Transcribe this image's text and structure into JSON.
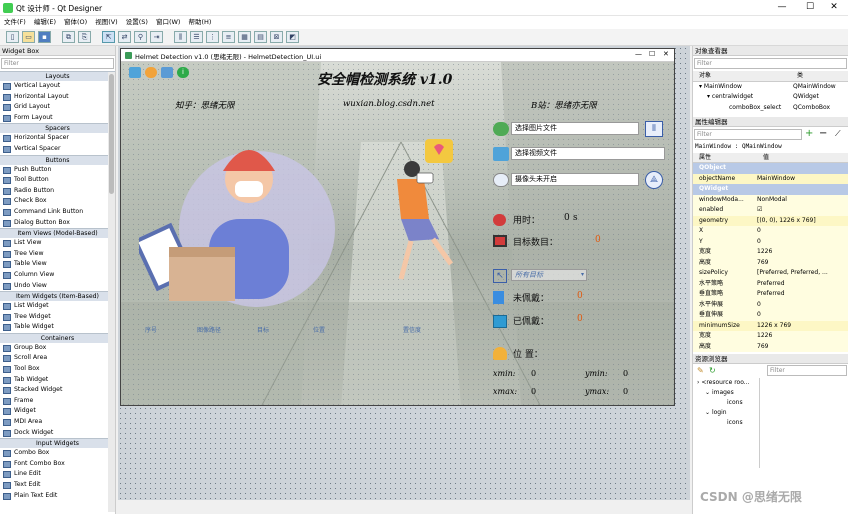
{
  "window": {
    "title": "Qt 设计师 - Qt Designer",
    "minimize": "—",
    "maximize": "☐",
    "close": "✕"
  },
  "menu": [
    "文件(F)",
    "编辑(E)",
    "窗体(O)",
    "视图(V)",
    "设置(S)",
    "窗口(W)",
    "帮助(H)"
  ],
  "widget_box": {
    "title": "Widget Box",
    "filter_placeholder": "Filter",
    "sections": [
      {
        "name": "Layouts",
        "items": [
          "Vertical Layout",
          "Horizontal Layout",
          "Grid Layout",
          "Form Layout"
        ]
      },
      {
        "name": "Spacers",
        "items": [
          "Horizontal Spacer",
          "Vertical Spacer"
        ]
      },
      {
        "name": "Buttons",
        "items": [
          "Push Button",
          "Tool Button",
          "Radio Button",
          "Check Box",
          "Command Link Button",
          "Dialog Button Box"
        ]
      },
      {
        "name": "Item Views (Model-Based)",
        "items": [
          "List View",
          "Tree View",
          "Table View",
          "Column View",
          "Undo View"
        ]
      },
      {
        "name": "Item Widgets (Item-Based)",
        "items": [
          "List Widget",
          "Tree Widget",
          "Table Widget"
        ]
      },
      {
        "name": "Containers",
        "items": [
          "Group Box",
          "Scroll Area",
          "Tool Box",
          "Tab Widget",
          "Stacked Widget",
          "Frame",
          "Widget",
          "MDI Area",
          "Dock Widget"
        ]
      },
      {
        "name": "Input Widgets",
        "items": [
          "Combo Box",
          "Font Combo Box",
          "Line Edit",
          "Text Edit",
          "Plain Text Edit"
        ]
      }
    ]
  },
  "form": {
    "title": "Helmet Detection v1.0 (思绪无限)  - HelmetDetection_UI.ui",
    "heading": "安全帽检测系统  v1.0",
    "zhihu": "知乎：思绪无限",
    "website": "wuxian.blog.csdn.net",
    "bilibili": "B站：思绪亦无限",
    "btn_image": "选择图片文件",
    "btn_video": "选择视频文件",
    "btn_camera": "摄像头未开启",
    "time_label": "用时：",
    "time_value": "0",
    "time_unit": "s",
    "target_label": "目标数目：",
    "target_value": "0",
    "combo_text": "所有目标",
    "unworn_label": "未佩戴：",
    "unworn_value": "0",
    "worn_label": "已佩戴：",
    "worn_value": "0",
    "position_label": "位  置：",
    "xmin_label": "xmin:",
    "xmin_value": "0",
    "ymin_label": "ymin:",
    "ymin_value": "0",
    "xmax_label": "xmax:",
    "xmax_value": "0",
    "ymax_label": "ymax:",
    "ymax_value": "0",
    "table_headers": [
      "序号",
      "图像路径",
      "目标",
      "位置",
      "置信度"
    ]
  },
  "object_inspector": {
    "title": "对象查看器",
    "filter_placeholder": "Filter",
    "col_object": "对象",
    "col_class": "类",
    "rows": [
      {
        "name": "MainWindow",
        "cls": "QMainWindow"
      },
      {
        "name": "centralwidget",
        "cls": "QWidget"
      },
      {
        "name": "comboBox_select",
        "cls": "QComboBox"
      }
    ]
  },
  "property_editor": {
    "title": "属性编辑器",
    "filter_placeholder": "Filter",
    "context": "MainWindow : QMainWindow",
    "col_prop": "属性",
    "col_val": "值",
    "rows": [
      {
        "p": "QObject",
        "v": "",
        "t": "sec"
      },
      {
        "p": "objectName",
        "v": "MainWindow",
        "t": "y2"
      },
      {
        "p": "QWidget",
        "v": "",
        "t": "sec"
      },
      {
        "p": "windowModa...",
        "v": "NonModal",
        "t": "y1"
      },
      {
        "p": "enabled",
        "v": "☑",
        "t": "y1"
      },
      {
        "p": "geometry",
        "v": "[(0, 0), 1226 x 769]",
        "t": "y2"
      },
      {
        "p": "X",
        "v": "0",
        "t": "y1"
      },
      {
        "p": "Y",
        "v": "0",
        "t": "y1"
      },
      {
        "p": "宽度",
        "v": "1226",
        "t": "y1"
      },
      {
        "p": "高度",
        "v": "769",
        "t": "y1"
      },
      {
        "p": "sizePolicy",
        "v": "[Preferred, Preferred, ...",
        "t": "y1"
      },
      {
        "p": "水平策略",
        "v": "Preferred",
        "t": "y1"
      },
      {
        "p": "垂直策略",
        "v": "Preferred",
        "t": "y1"
      },
      {
        "p": "水平伸展",
        "v": "0",
        "t": "y1"
      },
      {
        "p": "垂直伸展",
        "v": "0",
        "t": "y1"
      },
      {
        "p": "minimumSize",
        "v": "1226 x 769",
        "t": "y2"
      },
      {
        "p": "宽度",
        "v": "1226",
        "t": "y1"
      },
      {
        "p": "高度",
        "v": "769",
        "t": "y1"
      }
    ]
  },
  "resource_browser": {
    "title": "资源浏览器",
    "filter_placeholder": "Filter",
    "tree": [
      "<resource roo...",
      "images",
      "icons",
      "login",
      "icons"
    ]
  },
  "watermark": "CSDN @思绪无限",
  "colors": {
    "accent_orange": "#e05a10",
    "section_blue": "#b8c9e6",
    "selection": "#cce0f4"
  }
}
